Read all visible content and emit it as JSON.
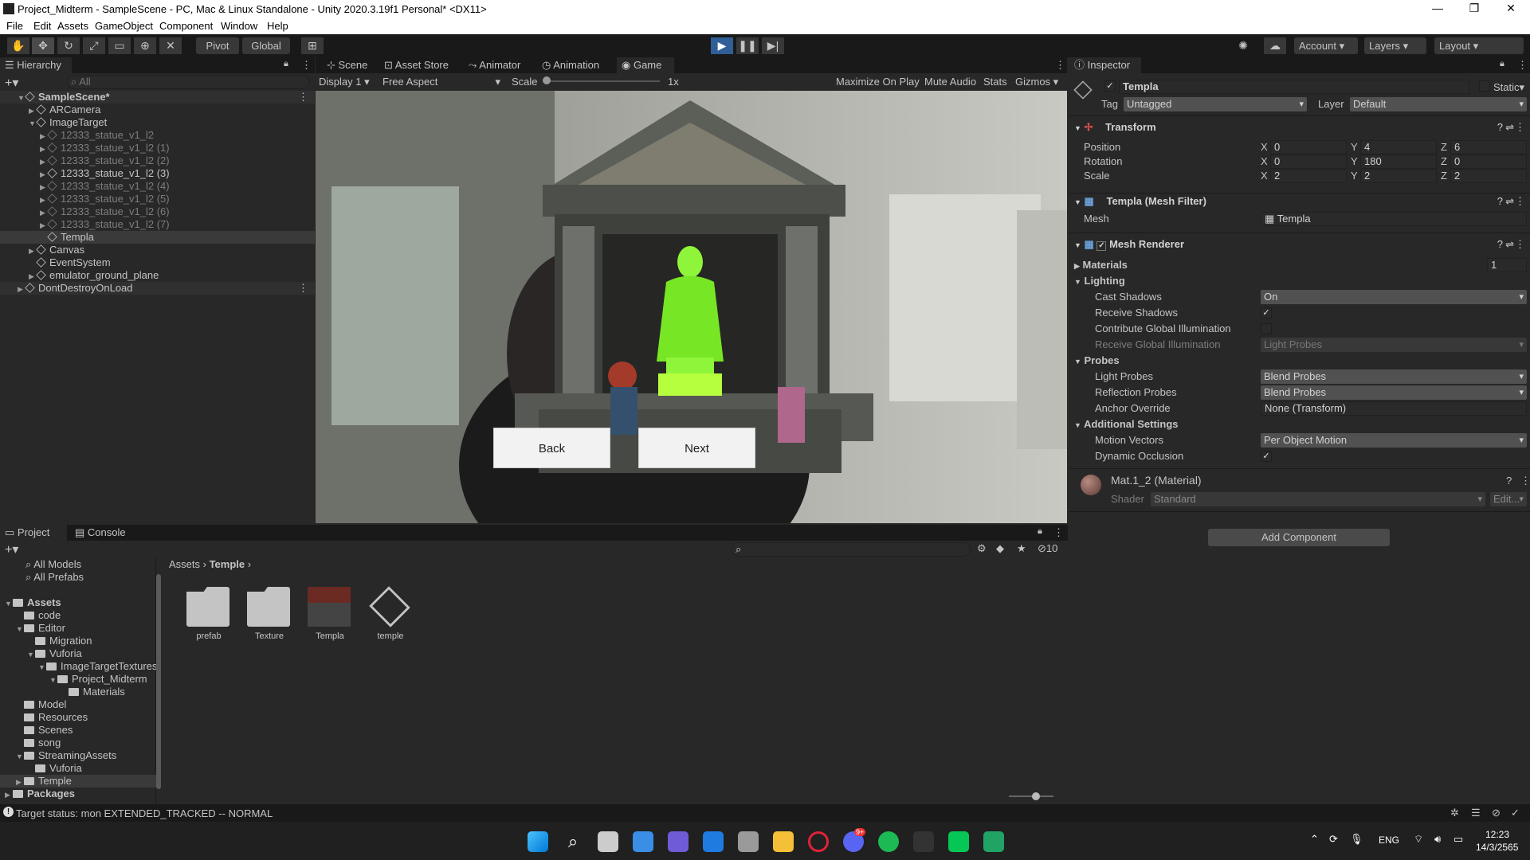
{
  "title": "Project_Midterm - SampleScene - PC, Mac & Linux Standalone - Unity 2020.3.19f1 Personal* <DX11>",
  "menu": [
    "File",
    "Edit",
    "Assets",
    "GameObject",
    "Component",
    "Window",
    "Help"
  ],
  "toolbar": {
    "pivot": "Pivot",
    "global": "Global",
    "account": "Account",
    "layers": "Layers",
    "layout": "Layout"
  },
  "hierarchy": {
    "tab": "Hierarchy",
    "search": "All",
    "items": [
      {
        "label": "SampleScene*",
        "depth": 0,
        "bold": true,
        "dim": false
      },
      {
        "label": "ARCamera",
        "depth": 1,
        "dim": false
      },
      {
        "label": "ImageTarget",
        "depth": 1,
        "dim": false
      },
      {
        "label": "12333_statue_v1_l2",
        "depth": 2,
        "dim": true
      },
      {
        "label": "12333_statue_v1_l2 (1)",
        "depth": 2,
        "dim": true
      },
      {
        "label": "12333_statue_v1_l2 (2)",
        "depth": 2,
        "dim": true
      },
      {
        "label": "12333_statue_v1_l2 (3)",
        "depth": 2,
        "dim": false
      },
      {
        "label": "12333_statue_v1_l2 (4)",
        "depth": 2,
        "dim": true
      },
      {
        "label": "12333_statue_v1_l2 (5)",
        "depth": 2,
        "dim": true
      },
      {
        "label": "12333_statue_v1_l2 (6)",
        "depth": 2,
        "dim": true
      },
      {
        "label": "12333_statue_v1_l2 (7)",
        "depth": 2,
        "dim": true
      },
      {
        "label": "Templa",
        "depth": 2,
        "dim": false,
        "selected": true
      },
      {
        "label": "Canvas",
        "depth": 1,
        "dim": false
      },
      {
        "label": "EventSystem",
        "depth": 1,
        "dim": false
      },
      {
        "label": "emulator_ground_plane",
        "depth": 1,
        "dim": false
      },
      {
        "label": "DontDestroyOnLoad",
        "depth": 0,
        "dim": false
      }
    ]
  },
  "center_tabs": [
    "Scene",
    "Asset Store",
    "Animator",
    "Animation",
    "Game"
  ],
  "game_bar": {
    "display": "Display 1",
    "aspect": "Free Aspect",
    "scale": "Scale",
    "scale_val": "1x",
    "maximize": "Maximize On Play",
    "mute": "Mute Audio",
    "stats": "Stats",
    "gizmos": "Gizmos"
  },
  "game_buttons": {
    "back": "Back",
    "next": "Next"
  },
  "inspector": {
    "tab": "Inspector",
    "name": "Templa",
    "static": "Static",
    "tag_label": "Tag",
    "tag": "Untagged",
    "layer_label": "Layer",
    "layer": "Default",
    "transform": {
      "title": "Transform",
      "rows": [
        {
          "label": "Position",
          "x": "0",
          "y": "4",
          "z": "6"
        },
        {
          "label": "Rotation",
          "x": "0",
          "y": "180",
          "z": "0"
        },
        {
          "label": "Scale",
          "x": "2",
          "y": "2",
          "z": "2"
        }
      ]
    },
    "meshfilter": {
      "title": "Templa (Mesh Filter)",
      "mesh_label": "Mesh",
      "mesh": "Templa"
    },
    "renderer": {
      "title": "Mesh Renderer",
      "materials": "Materials",
      "materials_count": "1",
      "lighting": "Lighting",
      "cast_shadows": "Cast Shadows",
      "cast_val": "On",
      "receive_shadows": "Receive Shadows",
      "contribute_gi": "Contribute Global Illumination",
      "receive_gi": "Receive Global Illumination",
      "receive_gi_val": "Light Probes",
      "probes": "Probes",
      "light_probes": "Light Probes",
      "light_probes_val": "Blend Probes",
      "reflection_probes": "Reflection Probes",
      "reflection_val": "Blend Probes",
      "anchor": "Anchor Override",
      "anchor_val": "None (Transform)",
      "additional": "Additional Settings",
      "motion": "Motion Vectors",
      "motion_val": "Per Object Motion",
      "dynamic": "Dynamic Occlusion"
    },
    "material": {
      "title": "Mat.1_2 (Material)",
      "shader_label": "Shader",
      "shader": "Standard",
      "edit": "Edit..."
    },
    "add_component": "Add Component"
  },
  "project": {
    "tabs": [
      "Project",
      "Console"
    ],
    "breadcrumb": [
      "Assets",
      "Temple"
    ],
    "count": "10",
    "favorites": [
      "All Models",
      "All Prefabs"
    ],
    "tree": [
      {
        "label": "Assets",
        "depth": 0,
        "bold": true
      },
      {
        "label": "code",
        "depth": 1
      },
      {
        "label": "Editor",
        "depth": 1
      },
      {
        "label": "Migration",
        "depth": 2
      },
      {
        "label": "Vuforia",
        "depth": 2
      },
      {
        "label": "ImageTargetTextures",
        "depth": 3
      },
      {
        "label": "Project_Midterm",
        "depth": 4
      },
      {
        "label": "Materials",
        "depth": 5
      },
      {
        "label": "Model",
        "depth": 1
      },
      {
        "label": "Resources",
        "depth": 1
      },
      {
        "label": "Scenes",
        "depth": 1
      },
      {
        "label": "song",
        "depth": 1
      },
      {
        "label": "StreamingAssets",
        "depth": 1
      },
      {
        "label": "Vuforia",
        "depth": 2
      },
      {
        "label": "Temple",
        "depth": 1,
        "selected": true
      },
      {
        "label": "Packages",
        "depth": 0,
        "bold": true
      }
    ],
    "assets": [
      "prefab",
      "Texture",
      "Templa",
      "temple"
    ]
  },
  "status": "Target status: mon EXTENDED_TRACKED -- NORMAL",
  "tray": {
    "lang": "ENG",
    "time": "12:23",
    "date": "14/3/2565",
    "badge": "9+"
  }
}
